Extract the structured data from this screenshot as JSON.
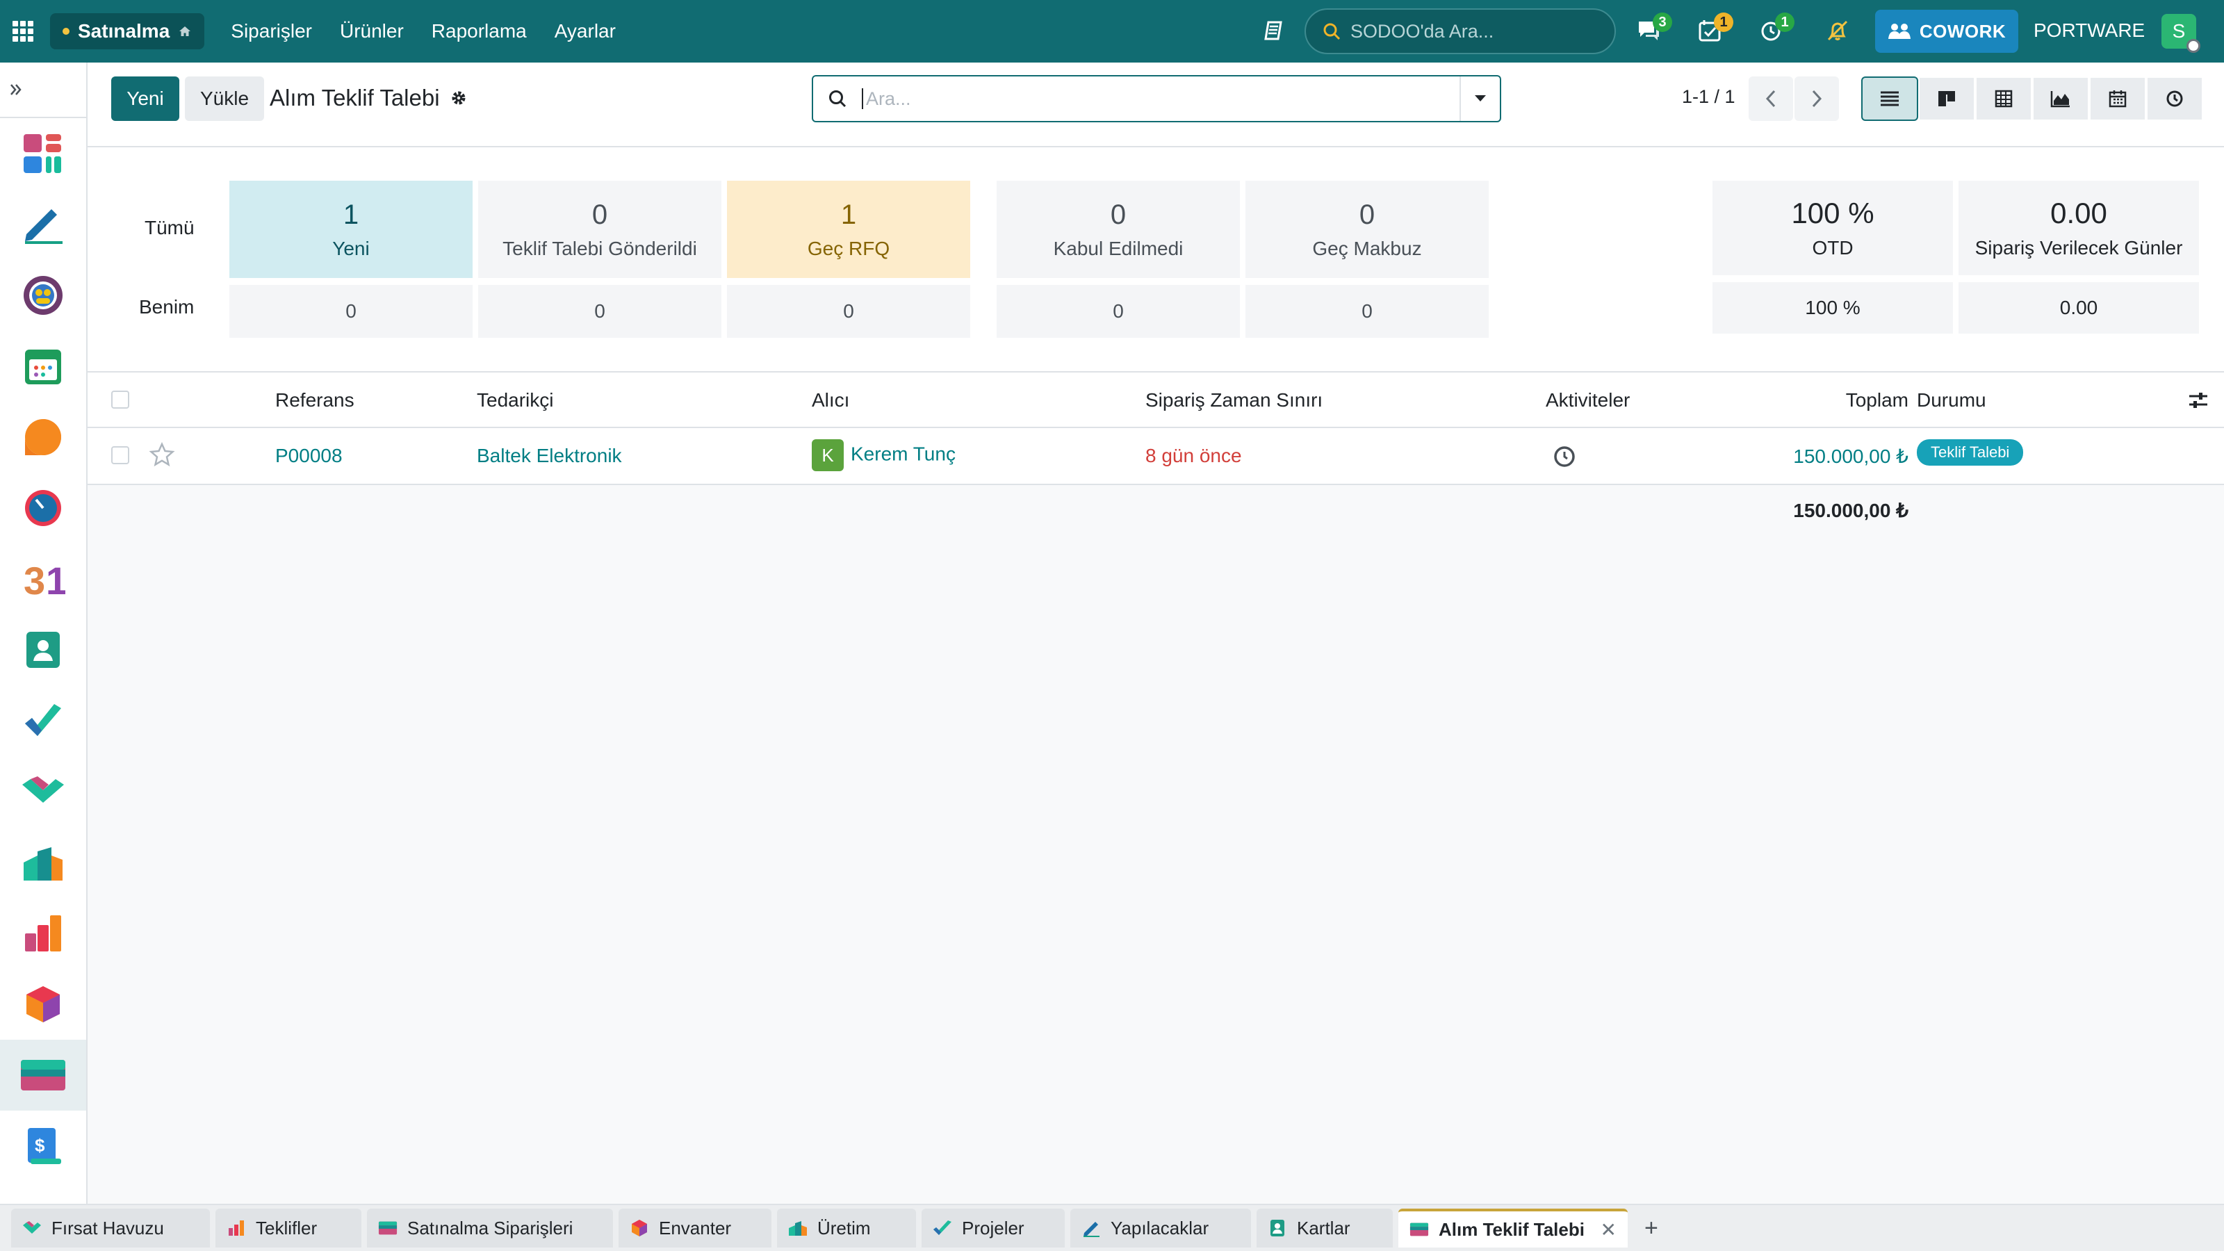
{
  "topbar": {
    "app_name": "Satınalma",
    "menu": [
      "Siparişler",
      "Ürünler",
      "Raporlama",
      "Ayarlar"
    ],
    "search_placeholder": "SODOO'da Ara...",
    "badges": {
      "messages": "3",
      "activities": "1",
      "timer": "1"
    },
    "cowork_label": "COWORK",
    "company": "PORTWARE",
    "user_initial": "S"
  },
  "control_panel": {
    "new_label": "Yeni",
    "upload_label": "Yükle",
    "title": "Alım Teklif Talebi",
    "search_placeholder": "Ara...",
    "pager": "1-1 / 1"
  },
  "dashboard": {
    "row_labels": [
      "Tümü",
      "Benim"
    ],
    "cards": [
      {
        "value": "1",
        "label": "Yeni",
        "mine": "0"
      },
      {
        "value": "0",
        "label": "Teklif Talebi Gönderildi",
        "mine": "0"
      },
      {
        "value": "1",
        "label": "Geç RFQ",
        "mine": "0"
      },
      {
        "value": "0",
        "label": "Kabul Edilmedi",
        "mine": "0"
      },
      {
        "value": "0",
        "label": "Geç Makbuz",
        "mine": "0"
      }
    ],
    "kpis": [
      {
        "value": "100 %",
        "label": "OTD",
        "mine": "100 %"
      },
      {
        "value": "0.00",
        "label": "Sipariş Verilecek Günler",
        "mine": "0.00"
      }
    ]
  },
  "table": {
    "columns": [
      "Referans",
      "Tedarikçi",
      "Alıcı",
      "Sipariş Zaman Sınırı",
      "Aktiviteler",
      "Toplam",
      "Durumu"
    ],
    "rows": [
      {
        "reference": "P00008",
        "vendor": "Baltek Elektronik",
        "buyer_initial": "K",
        "buyer": "Kerem Tunç",
        "deadline": "8 gün önce",
        "total": "150.000,00 ₺",
        "status": "Teklif Talebi"
      }
    ],
    "sum_total": "150.000,00 ₺"
  },
  "bottom_tabs": [
    "Fırsat Havuzu",
    "Teklifler",
    "Satınalma Siparişleri",
    "Envanter",
    "Üretim",
    "Projeler",
    "Yapılacaklar",
    "Kartlar",
    "Alım Teklif Talebi"
  ],
  "colors": {
    "primary": "#116c72",
    "link": "#017e84",
    "danger": "#d23f3a",
    "status": "#17a2b8",
    "cowork": "#1a86bd"
  }
}
